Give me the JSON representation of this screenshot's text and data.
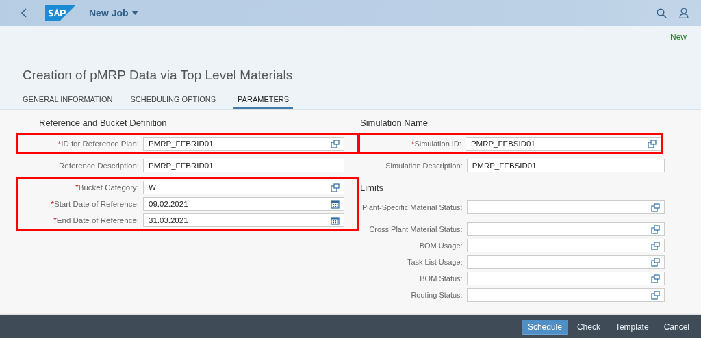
{
  "shell": {
    "title": "New Job"
  },
  "header": {
    "status": "New",
    "title": "Creation of pMRP Data via Top Level Materials"
  },
  "tabs": [
    {
      "label": "GENERAL INFORMATION",
      "selected": false
    },
    {
      "label": "SCHEDULING OPTIONS",
      "selected": false
    },
    {
      "label": "PARAMETERS",
      "selected": true
    }
  ],
  "sections": [
    {
      "title": "Reference and Bucket Definition",
      "groups": [
        {
          "highlighted": true,
          "fields": [
            {
              "label": "ID for Reference Plan:",
              "marker": "*",
              "value": "PMRP_FEBRID01",
              "kind": "value_help"
            }
          ]
        },
        {
          "highlighted": false,
          "fields": [
            {
              "label": "Reference Description:",
              "value": "PMRP_FEBRID01",
              "kind": "text"
            }
          ]
        },
        {
          "highlighted": true,
          "fields": [
            {
              "label": "Bucket Category:",
              "marker": "*",
              "value": "W",
              "kind": "value_help"
            },
            {
              "label": "Start Date of Reference:",
              "marker": "*",
              "value": "09.02.2021",
              "kind": "date"
            },
            {
              "label": "End Date of Reference:",
              "marker": "*",
              "value": "31.03.2021",
              "kind": "date"
            }
          ]
        }
      ]
    },
    {
      "title": "Simulation Name",
      "groups": [
        {
          "highlighted": true,
          "fields": [
            {
              "label": "Simulation ID:",
              "marker": "*",
              "value": "PMRP_FEBSID01",
              "kind": "value_help"
            }
          ]
        },
        {
          "highlighted": false,
          "fields": [
            {
              "label": "Simulation Description:",
              "value": "PMRP_FEBSID01",
              "kind": "text"
            }
          ]
        }
      ]
    },
    {
      "title": "Limits",
      "groups": [
        {
          "highlighted": false,
          "fields": [
            {
              "label": "Plant-Specific Material Status:",
              "kind": "value_help"
            },
            {
              "label": "Cross Plant Material Status:",
              "kind": "value_help"
            },
            {
              "label": "BOM Usage:",
              "kind": "value_help"
            },
            {
              "label": "Task List Usage:",
              "kind": "value_help"
            },
            {
              "label": "BOM Status:",
              "kind": "value_help"
            },
            {
              "label": "Routing Status:",
              "kind": "value_help"
            }
          ]
        }
      ]
    }
  ],
  "footer": {
    "buttons": [
      {
        "label": "Schedule",
        "kind": "emphasized"
      },
      {
        "label": "Check",
        "kind": "plain"
      },
      {
        "label": "Template",
        "kind": "plain"
      },
      {
        "label": "Cancel",
        "kind": "plain"
      }
    ]
  }
}
